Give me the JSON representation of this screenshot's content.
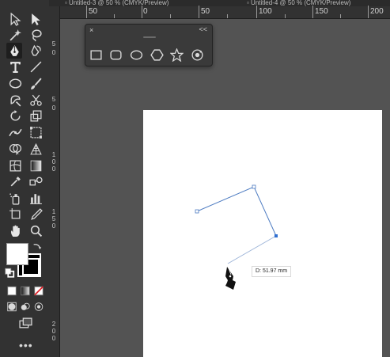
{
  "tabs": [
    "▫ Untitled-3 @ 50 % (CMYK/Preview)",
    "▫ Untitled-4 @ 50 % (CMYK/Preview)"
  ],
  "ruler": {
    "horizontal": [
      "50",
      "0",
      "50",
      "100",
      "150",
      "200"
    ],
    "vertical": [
      "5",
      "0",
      "5",
      "0",
      "1",
      "0",
      "0",
      "1",
      "5",
      "0",
      "2",
      "0",
      "0"
    ]
  },
  "panel": {
    "close": "×",
    "collapse": "<<",
    "shapes": [
      "rectangle-tool",
      "rounded-rectangle-tool",
      "ellipse-tool",
      "polygon-tool",
      "star-tool",
      "flare-tool"
    ]
  },
  "measure_label": "D: 51.97 mm",
  "more_tools": "•••",
  "colors": {
    "accent": "#1473e6",
    "path": "#5b86c7",
    "background": "#535353",
    "toolbar": "#323232"
  }
}
